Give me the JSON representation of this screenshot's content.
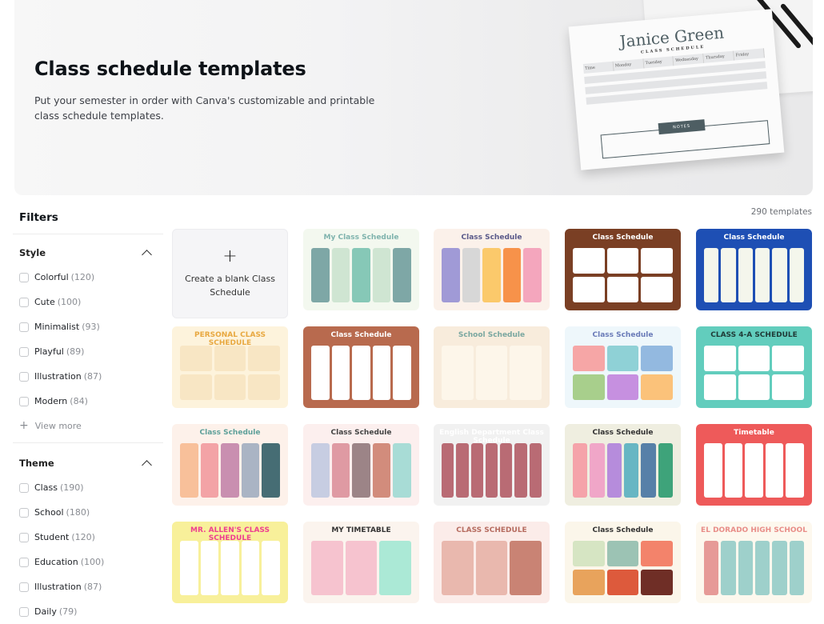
{
  "banner": {
    "title": "Class schedule templates",
    "description": "Put your semester in order with Canva's customizable and printable class schedule templates.",
    "preview": {
      "name": "Janice Green",
      "subtitle": "CLASS SCHEDULE",
      "days": [
        "Time",
        "Monday",
        "Tuesday",
        "Wednesday",
        "Thursday",
        "Friday"
      ],
      "notes_label": "NOTES"
    }
  },
  "sidebar": {
    "title": "Filters",
    "sections": [
      {
        "label": "Style",
        "options": [
          {
            "label": "Colorful",
            "count": "(120)"
          },
          {
            "label": "Cute",
            "count": "(100)"
          },
          {
            "label": "Minimalist",
            "count": "(93)"
          },
          {
            "label": "Playful",
            "count": "(89)"
          },
          {
            "label": "Illustration",
            "count": "(87)"
          },
          {
            "label": "Modern",
            "count": "(84)"
          }
        ],
        "view_more": "View more"
      },
      {
        "label": "Theme",
        "options": [
          {
            "label": "Class",
            "count": "(190)"
          },
          {
            "label": "School",
            "count": "(180)"
          },
          {
            "label": "Student",
            "count": "(120)"
          },
          {
            "label": "Education",
            "count": "(100)"
          },
          {
            "label": "Illustration",
            "count": "(87)"
          },
          {
            "label": "Daily",
            "count": "(79)"
          }
        ]
      }
    ]
  },
  "results": {
    "count_label": "290 templates",
    "blank_card": {
      "plus": "+",
      "label": "Create a blank Class Schedule"
    },
    "templates": [
      {
        "title": "My Class Schedule",
        "bg": "#f3f8ef",
        "fg": "#7fb3ad",
        "tiles": [
          "#7ea7a6",
          "#cfe5d2",
          "#86c8b7",
          "#cfe5d2",
          "#7ea7a6"
        ]
      },
      {
        "title": "Class Schedule",
        "bg": "#fbf1ea",
        "fg": "#5a5a8a",
        "tiles": [
          "#a09ad6",
          "#d7d7d7",
          "#fbc96b",
          "#f7924a",
          "#f4a6bd"
        ]
      },
      {
        "title": "Class Schedule",
        "bg": "#7a3f24",
        "fg": "#ffffff",
        "tiles": [
          "#ffffff",
          "#ffffff",
          "#ffffff",
          "#ffffff",
          "#ffffff",
          "#ffffff"
        ]
      },
      {
        "title": "Class Schedule",
        "bg": "#1e4fb4",
        "fg": "#ffffff",
        "tiles": [
          "#f4f6ec",
          "#f4f6ec",
          "#f4f6ec",
          "#f4f6ec",
          "#f4f6ec",
          "#f4f6ec"
        ]
      },
      {
        "title": "PERSONAL CLASS SCHEDULE",
        "bg": "#fdf3dc",
        "fg": "#e8a840",
        "tiles": [
          "#f8e6c4",
          "#f8e6c4",
          "#f8e6c4",
          "#f8e6c4",
          "#f8e6c4",
          "#f8e6c4"
        ]
      },
      {
        "title": "Class Schedule",
        "bg": "#b86a4e",
        "fg": "#ffffff",
        "tiles": [
          "#ffffff",
          "#ffffff",
          "#ffffff",
          "#ffffff",
          "#ffffff"
        ]
      },
      {
        "title": "School Schedule",
        "bg": "#f8ecdc",
        "fg": "#7aa7a0",
        "tiles": [
          "#fdf6ea",
          "#fdf6ea",
          "#fdf6ea"
        ]
      },
      {
        "title": "Class Schedule",
        "bg": "#eef7fb",
        "fg": "#6a7bb8",
        "tiles": [
          "#f6a6a6",
          "#8fd1d6",
          "#93b9e0",
          "#a8cf8c",
          "#c690e0",
          "#fbc27a"
        ]
      },
      {
        "title": "CLASS 4-A SCHEDULE",
        "bg": "#62cdbd",
        "fg": "#1f3a36",
        "tiles": [
          "#ffffff",
          "#ffffff",
          "#ffffff",
          "#ffffff",
          "#ffffff",
          "#ffffff"
        ]
      },
      {
        "title": "Class Schedule",
        "bg": "#fdf1ea",
        "fg": "#5ea09a",
        "tiles": [
          "#f8c09a",
          "#f3a3a6",
          "#c98fb0",
          "#aab4c4",
          "#466d74"
        ]
      },
      {
        "title": "Class Schedule",
        "bg": "#fcefee",
        "fg": "#444444",
        "tiles": [
          "#c7cde2",
          "#df9aa3",
          "#9c8487",
          "#d28c7c",
          "#a8dcd6"
        ]
      },
      {
        "title": "English Department Class Schedule",
        "bg": "#f1f1f1",
        "fg": "#ffffff",
        "tiles": [
          "#b96b74",
          "#b96b74",
          "#b96b74",
          "#b96b74",
          "#b96b74",
          "#b96b74",
          "#b96b74"
        ]
      },
      {
        "title": "Class Schedule",
        "bg": "#efeee0",
        "fg": "#333333",
        "tiles": [
          "#f5a3aa",
          "#f0a6c8",
          "#b68cdc",
          "#67b6c3",
          "#5780a8",
          "#3ea37a"
        ]
      },
      {
        "title": "Timetable",
        "bg": "#ee5a5a",
        "fg": "#ffffff",
        "tiles": [
          "#ffffff",
          "#ffffff",
          "#ffffff",
          "#ffffff",
          "#ffffff"
        ]
      },
      {
        "title": "MR. ALLEN'S CLASS SCHEDULE",
        "bg": "#f8f09a",
        "fg": "#ee3f8f",
        "tiles": [
          "#ffffff",
          "#ffffff",
          "#ffffff",
          "#ffffff",
          "#ffffff"
        ]
      },
      {
        "title": "MY TIMETABLE",
        "bg": "#fbf4ee",
        "fg": "#333333",
        "tiles": [
          "#f6c3cf",
          "#f6c3cf",
          "#abe9d6"
        ]
      },
      {
        "title": "CLASS SCHEDULE",
        "bg": "#fbece9",
        "fg": "#b66c60",
        "tiles": [
          "#e9b8ae",
          "#e9b8ae",
          "#c98374"
        ]
      },
      {
        "title": "Class Schedule",
        "bg": "#fbf6ea",
        "fg": "#333333",
        "tiles": [
          "#d6e5c3",
          "#9cc3b4",
          "#f3836b",
          "#e8a35c",
          "#dd5a3c",
          "#6f2e26"
        ]
      },
      {
        "title": "EL DORADO HIGH SCHOOL",
        "bg": "#fdf8ee",
        "fg": "#e88d88",
        "tiles": [
          "#e69a97",
          "#9ed0cb",
          "#9ed0cb",
          "#9ed0cb",
          "#9ed0cb",
          "#9ed0cb"
        ]
      }
    ]
  }
}
